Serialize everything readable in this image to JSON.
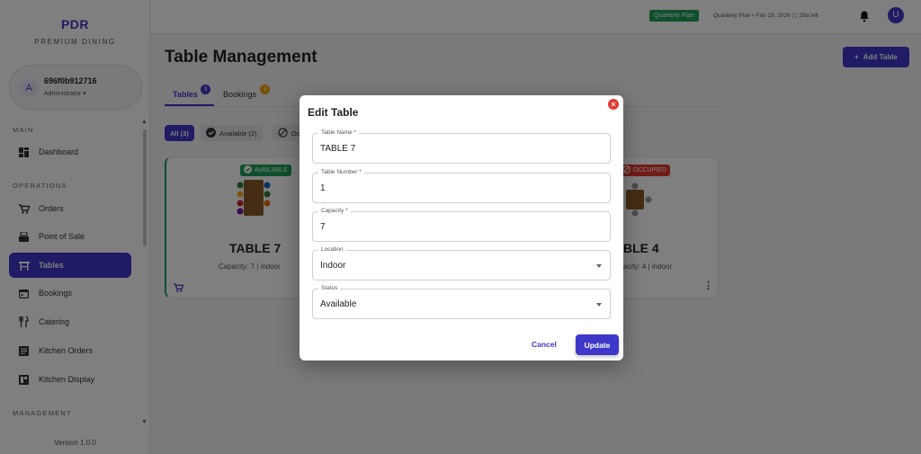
{
  "sidebar": {
    "brand": "PDR",
    "brand_sub": "PREMIUM DINING",
    "user": {
      "initial": "A",
      "name": "696f0b912716",
      "role": "Administrator ▾"
    },
    "sections": {
      "main": "MAIN",
      "operations": "OPERATIONS",
      "management": "MANAGEMENT"
    },
    "items": [
      {
        "label": "Dashboard",
        "icon": "dashboard-icon"
      },
      {
        "label": "Orders",
        "icon": "cart-icon"
      },
      {
        "label": "Point of Sale",
        "icon": "pos-icon"
      },
      {
        "label": "Tables",
        "icon": "table-icon",
        "active": true
      },
      {
        "label": "Bookings",
        "icon": "calendar-icon"
      },
      {
        "label": "Catering",
        "icon": "utensils-icon"
      },
      {
        "label": "Kitchen Orders",
        "icon": "list-icon"
      },
      {
        "label": "Kitchen Display",
        "icon": "display-icon"
      }
    ],
    "version": "Version 1.0.0"
  },
  "topbar": {
    "plan_badge": "Quarterly Plan",
    "plan_info": "Quarterly Plan • Feb 19, 2026  ▢ 29d left",
    "avatar_initial": "U"
  },
  "main": {
    "title": "Table Management",
    "add_button": "Add Table",
    "tabs": [
      {
        "label": "Tables",
        "count": "3"
      },
      {
        "label": "Bookings",
        "count": "3"
      }
    ],
    "filters": [
      {
        "label": "All (3)"
      },
      {
        "label": "Available (2)"
      },
      {
        "label": "Oc"
      }
    ],
    "cards": [
      {
        "name": "TABLE 7",
        "capacity": "Capacity: 7 | indoor",
        "status": "AVAILABLE"
      },
      {
        "name": "BLE 4",
        "capacity": "acity: 4 | indoor",
        "status": "OCCUPIED"
      }
    ]
  },
  "modal": {
    "title": "Edit Table",
    "fields": [
      {
        "label": "Table Name *",
        "value": "TABLE 7"
      },
      {
        "label": "Table Number *",
        "value": "1"
      },
      {
        "label": "Capacity *",
        "value": "7"
      },
      {
        "label": "Location",
        "value": "Indoor"
      },
      {
        "label": "Status",
        "value": "Available"
      }
    ],
    "cancel": "Cancel",
    "update": "Update"
  },
  "colors": {
    "primary": "#3f37c9",
    "success": "#1e9e57",
    "danger": "#e53935",
    "badge_orange": "#f0a500"
  }
}
